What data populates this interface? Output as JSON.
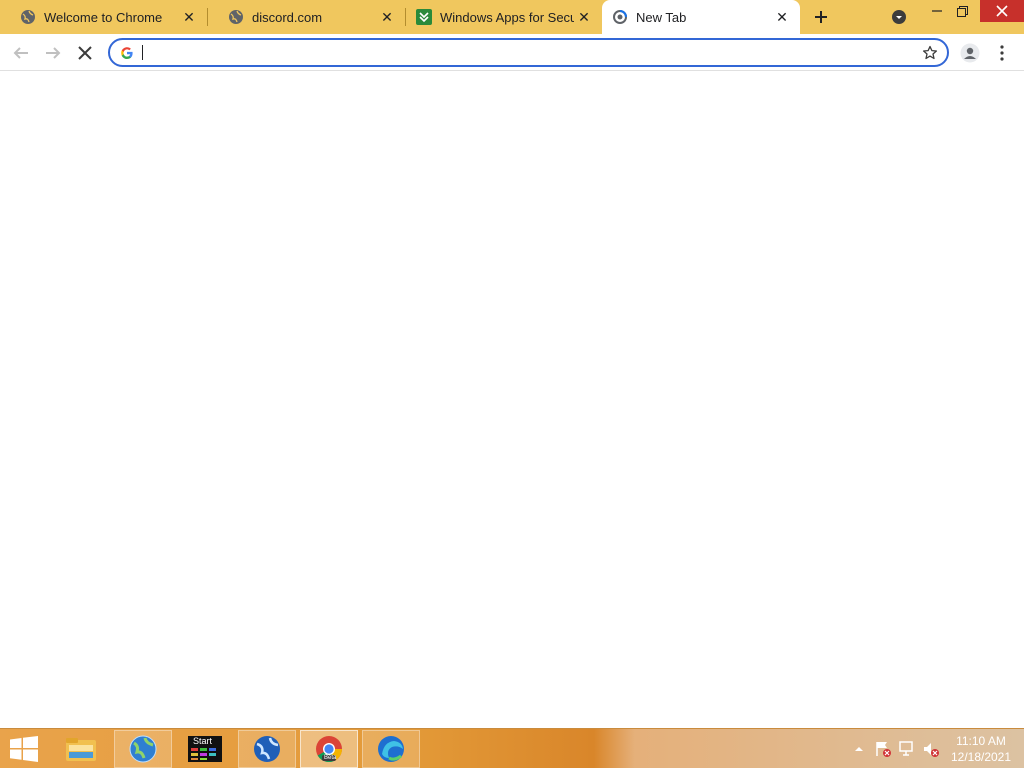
{
  "tabs": [
    {
      "title": "Welcome to Chrome",
      "icon": "globe-icon",
      "active": false
    },
    {
      "title": "discord.com",
      "icon": "globe-icon",
      "active": false
    },
    {
      "title": "Windows Apps for Secur",
      "icon": "softonic-icon",
      "active": false
    },
    {
      "title": "New Tab",
      "icon": "loading-icon",
      "active": true
    }
  ],
  "tab_close_glyph": "✕",
  "new_tab_glyph": "+",
  "omnibox": {
    "value": "",
    "placeholder": ""
  },
  "clock": {
    "time": "11:10 AM",
    "date": "12/18/2021"
  },
  "taskbar_apps": [
    {
      "name": "file-explorer-icon"
    },
    {
      "name": "globe-icon"
    },
    {
      "name": "start-app-icon",
      "label": "Start"
    },
    {
      "name": "globe-icon"
    },
    {
      "name": "chrome-beta-icon",
      "label": "Beta"
    },
    {
      "name": "edge-icon"
    }
  ],
  "colors": {
    "tabstrip": "#f0c75e",
    "accent": "#3367d6",
    "close": "#c7302b"
  }
}
